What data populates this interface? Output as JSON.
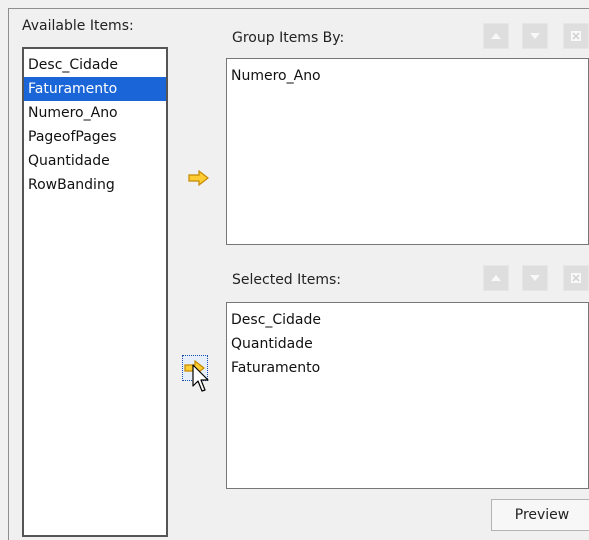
{
  "available": {
    "label": "Available Items:",
    "items": [
      {
        "label": "Desc_Cidade",
        "selected": false
      },
      {
        "label": "Faturamento",
        "selected": true
      },
      {
        "label": "Numero_Ano",
        "selected": false
      },
      {
        "label": "PageofPages",
        "selected": false
      },
      {
        "label": "Quantidade",
        "selected": false
      },
      {
        "label": "RowBanding",
        "selected": false
      }
    ]
  },
  "group_by": {
    "label": "Group Items By:",
    "items": [
      "Numero_Ano"
    ]
  },
  "selected": {
    "label": "Selected Items:",
    "items": [
      "Desc_Cidade",
      "Quantidade",
      "Faturamento"
    ]
  },
  "buttons": {
    "preview_label": "Preview"
  },
  "icons": {
    "add_to_group": "right-arrow-icon",
    "add_to_selected": "right-arrow-icon",
    "move_up": "triangle-up-icon",
    "move_down": "triangle-down-icon",
    "remove": "remove-icon",
    "cursor": "pointer-cursor-icon"
  },
  "colors": {
    "selection": "#1a66d8",
    "arrow_fill": "#ffcc33"
  }
}
